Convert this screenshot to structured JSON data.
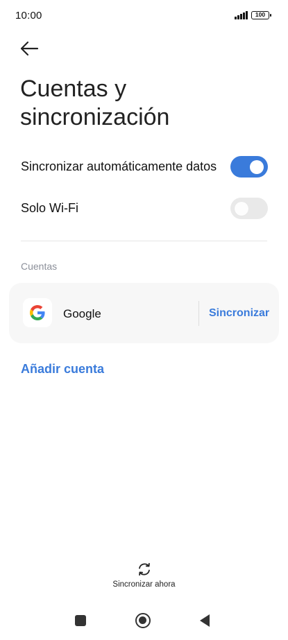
{
  "status_bar": {
    "time": "10:00",
    "battery": "100",
    "icons": [
      "signal-icon",
      "battery-icon"
    ]
  },
  "header": {
    "back_icon": "arrow-left-icon",
    "title": "Cuentas y sincronización"
  },
  "settings": {
    "auto_sync": {
      "label": "Sincronizar automáticamente datos",
      "enabled": true
    },
    "wifi_only": {
      "label": "Solo Wi-Fi",
      "enabled": false
    }
  },
  "accounts": {
    "section_label": "Cuentas",
    "items": [
      {
        "name": "Google",
        "icon": "google-logo-icon",
        "action": "Sincronizar"
      }
    ],
    "add_label": "Añadir cuenta"
  },
  "sync_now": {
    "icon": "sync-icon",
    "label": "Sincronizar ahora"
  },
  "nav_bar": {
    "icons": [
      "recents-icon",
      "home-icon",
      "back-icon"
    ]
  },
  "colors": {
    "accent": "#3a7bdb",
    "toggle_off": "#e9e9e9",
    "card_bg": "#f7f7f7",
    "section_text": "#8b8f99"
  }
}
